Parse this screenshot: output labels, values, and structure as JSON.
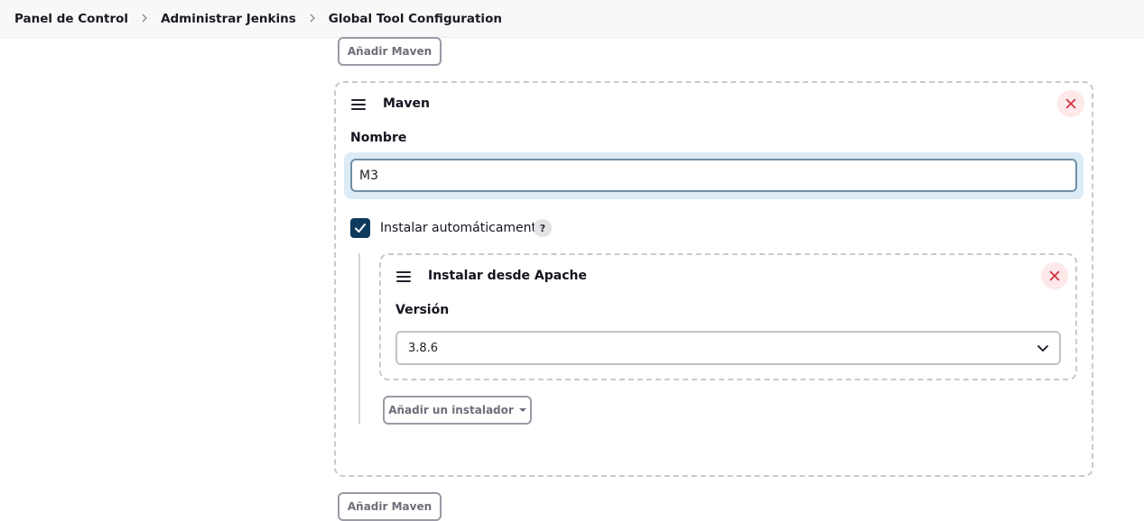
{
  "breadcrumb": {
    "items": [
      "Panel de Control",
      "Administrar Jenkins",
      "Global Tool Configuration"
    ],
    "separator": ">"
  },
  "add_maven_top": "Añadir Maven",
  "maven_panel": {
    "title": "Maven",
    "name_label": "Nombre",
    "name_value": "M3",
    "auto_install_label": "Instalar automáticamente",
    "auto_install_checked": true,
    "help_text": "?",
    "installer": {
      "title": "Instalar desde Apache",
      "version_label": "Versión",
      "version_value": "3.8.6"
    },
    "add_installer_label": "Añadir un instalador"
  },
  "add_maven_bottom": "Añadir Maven",
  "colors": {
    "checkbox": "#0e3a5e",
    "close_icon": "#d22c3c",
    "close_bg": "#fde8ea",
    "input_halo": "#dcebf6"
  },
  "icons": [
    "chevron-right-icon",
    "drag-handle-icon",
    "close-icon",
    "checkmark-icon",
    "help-icon",
    "chevron-down-icon",
    "caret-down-icon"
  ]
}
